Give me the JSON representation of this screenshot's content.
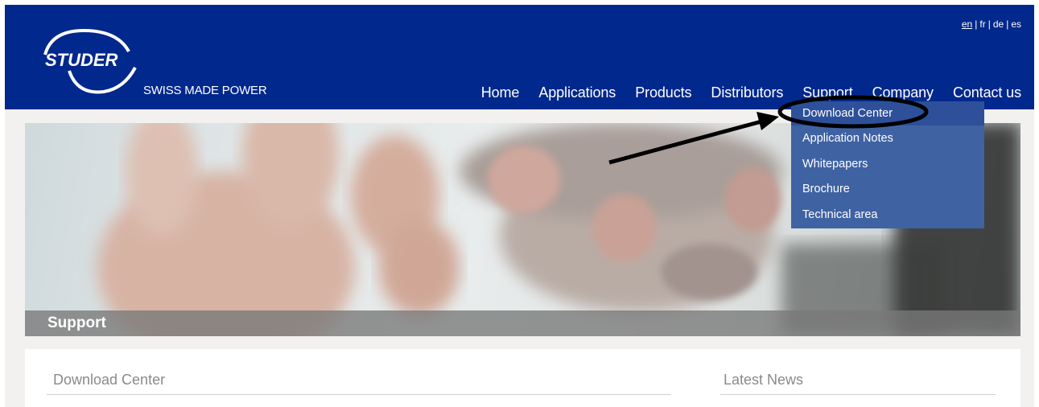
{
  "header": {
    "logo_text": "STUDER",
    "tagline": "SWISS MADE POWER",
    "brand_color": "#01288c"
  },
  "languages": {
    "items": [
      "en",
      "fr",
      "de",
      "es"
    ],
    "separator": "|",
    "current": "en"
  },
  "nav": {
    "items": [
      "Home",
      "Applications",
      "Products",
      "Distributors",
      "Support",
      "Company",
      "Contact us"
    ]
  },
  "support_menu": {
    "items": [
      "Download Center",
      "Application Notes",
      "Whitepapers",
      "Brochure",
      "Technical area"
    ],
    "highlighted": "Download Center"
  },
  "hero": {
    "title": "Support"
  },
  "content": {
    "main_section_title": "Download Center",
    "side_section_title": "Latest News"
  },
  "icons": {
    "annotation": [
      "circle-highlight-icon",
      "arrow-icon"
    ]
  }
}
